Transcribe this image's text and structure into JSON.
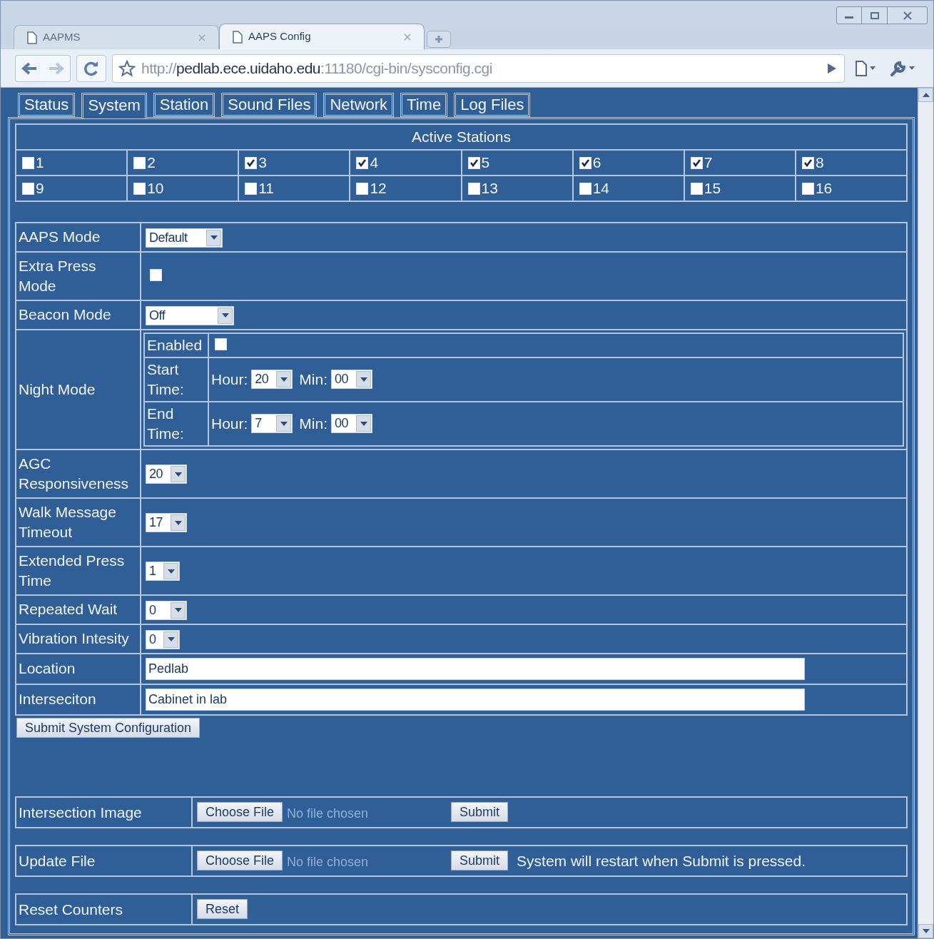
{
  "browser_tabs": [
    {
      "label": "AAPMS",
      "selected": false
    },
    {
      "label": "AAPS Config",
      "selected": true
    }
  ],
  "address_bar": {
    "scheme": "http://",
    "host": "pedlab.ece.uidaho.edu",
    "rest": ":11180/cgi-bin/sysconfig.cgi"
  },
  "page_tabs": [
    {
      "label": "Status",
      "selected": false
    },
    {
      "label": "System",
      "selected": true
    },
    {
      "label": "Station",
      "selected": false
    },
    {
      "label": "Sound Files",
      "selected": false
    },
    {
      "label": "Network",
      "selected": false
    },
    {
      "label": "Time",
      "selected": false
    },
    {
      "label": "Log Files",
      "selected": false
    }
  ],
  "active_stations": {
    "title": "Active Stations",
    "stations": [
      {
        "label": "1",
        "checked": false
      },
      {
        "label": "2",
        "checked": false
      },
      {
        "label": "3",
        "checked": true
      },
      {
        "label": "4",
        "checked": true
      },
      {
        "label": "5",
        "checked": true
      },
      {
        "label": "6",
        "checked": true
      },
      {
        "label": "7",
        "checked": true
      },
      {
        "label": "8",
        "checked": true
      },
      {
        "label": "9",
        "checked": false
      },
      {
        "label": "10",
        "checked": false
      },
      {
        "label": "11",
        "checked": false
      },
      {
        "label": "12",
        "checked": false
      },
      {
        "label": "13",
        "checked": false
      },
      {
        "label": "14",
        "checked": false
      },
      {
        "label": "15",
        "checked": false
      },
      {
        "label": "16",
        "checked": false
      }
    ]
  },
  "settings": [
    {
      "kind": "select",
      "label": "AAPS Mode",
      "value": "Default"
    },
    {
      "kind": "checkbox",
      "label": "Extra Press\nMode",
      "checked": false
    },
    {
      "kind": "select",
      "label": "Beacon Mode",
      "value": "Off"
    },
    {
      "kind": "night",
      "label": "Night Mode",
      "enabled_label": "Enabled",
      "enabled": false,
      "times": [
        {
          "label": "Start\nTime:",
          "hour_label": "Hour:",
          "hour": "20",
          "min_label": "Min:",
          "min": "00"
        },
        {
          "label": "End\nTime:",
          "hour_label": "Hour:",
          "hour": "7",
          "min_label": "Min:",
          "min": "00"
        }
      ]
    },
    {
      "kind": "select",
      "label": "AGC\nResponsiveness",
      "value": "20"
    },
    {
      "kind": "select",
      "label": "Walk Message\nTimeout",
      "value": "17"
    },
    {
      "kind": "select",
      "label": "Extended Press\nTime",
      "value": "1"
    },
    {
      "kind": "select",
      "label": "Repeated Wait",
      "value": "0"
    },
    {
      "kind": "select",
      "label": "Vibration Intesity",
      "value": "0"
    },
    {
      "kind": "text",
      "label": "Location",
      "value": "Pedlab"
    },
    {
      "kind": "text",
      "label": "Interseciton",
      "value": "Cabinet in lab"
    }
  ],
  "submit_button": "Submit System Configuration",
  "actions": [
    {
      "kind": "upload",
      "label": "Intersection Image",
      "choose": "Choose File",
      "status": "No file chosen",
      "submit": "Submit"
    },
    {
      "kind": "upload",
      "label": "Update File",
      "choose": "Choose File",
      "status": "No file chosen",
      "submit": "Submit",
      "note": "System will restart when Submit is pressed."
    },
    {
      "kind": "reset",
      "label": "Reset Counters",
      "button": "Reset"
    }
  ]
}
